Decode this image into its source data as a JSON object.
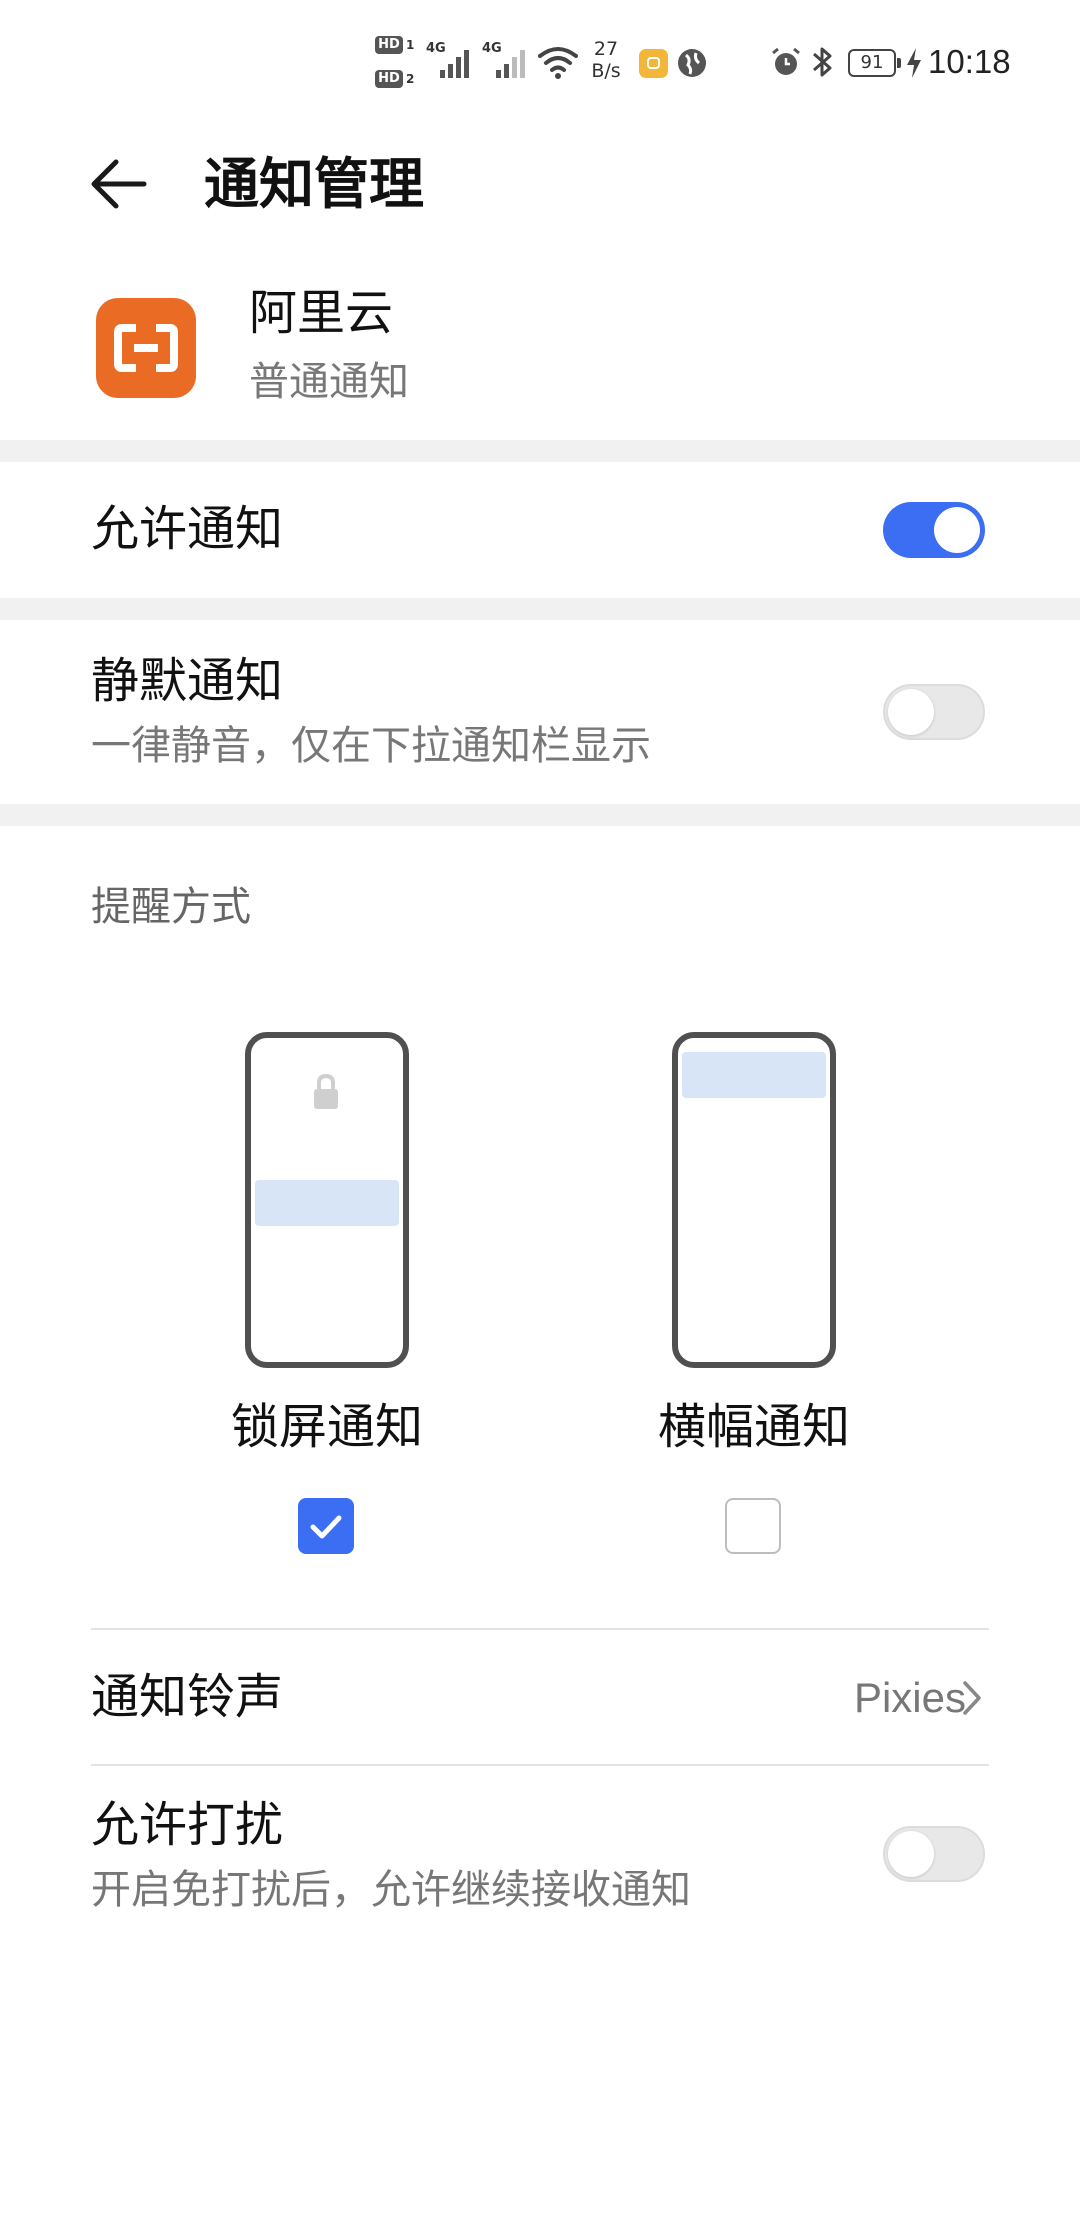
{
  "status_bar": {
    "hd1": "HD",
    "hd1_sim": "1",
    "hd2": "HD",
    "hd2_sim": "2",
    "net1": "4G",
    "net2": "4G",
    "speed_value": "27",
    "speed_unit": "B/s",
    "battery": "91",
    "time": "10:18"
  },
  "header": {
    "title": "通知管理",
    "back_icon": "arrow-left-icon"
  },
  "app": {
    "name": "阿里云",
    "category": "普通通知",
    "icon_color": "#ea6b24"
  },
  "settings": {
    "allow_notifications": {
      "label": "允许通知",
      "enabled": true
    },
    "silent_notifications": {
      "label": "静默通知",
      "description": "一律静音，仅在下拉通知栏显示",
      "enabled": false
    },
    "reminder": {
      "section_label": "提醒方式",
      "options": [
        {
          "label": "锁屏通知",
          "checked": true
        },
        {
          "label": "横幅通知",
          "checked": false
        }
      ]
    },
    "ringtone": {
      "label": "通知铃声",
      "value": "Pixies"
    },
    "allow_disturb": {
      "label": "允许打扰",
      "description": "开启免打扰后，允许继续接收通知",
      "enabled": false
    }
  },
  "colors": {
    "accent": "#3b6ef2",
    "toggle_off": "#e8e8e8",
    "illustration_bar": "#d8e5f6"
  }
}
